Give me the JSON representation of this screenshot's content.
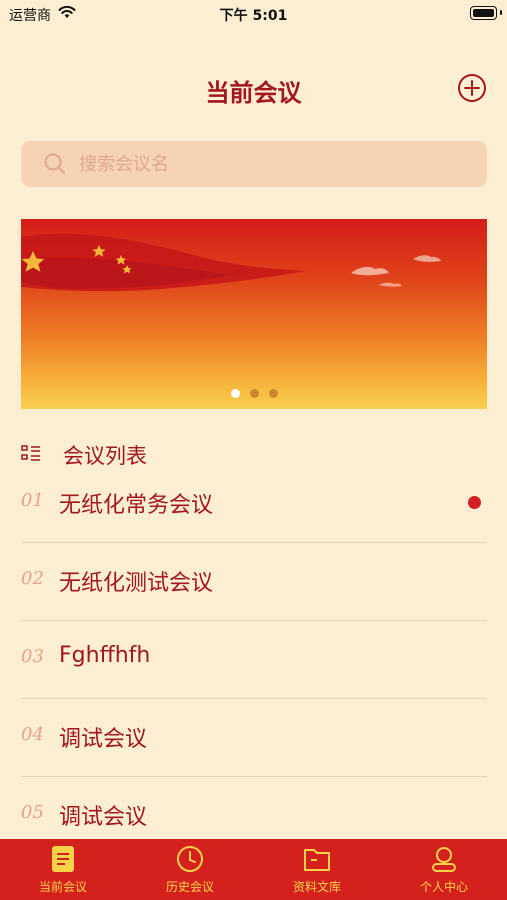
{
  "status_bar": {
    "carrier": "运营商",
    "time": "下午 5:01"
  },
  "header": {
    "title": "当前会议"
  },
  "search": {
    "placeholder": "搜索会议名",
    "value": ""
  },
  "banner": {
    "page_count": 3,
    "active_index": 0
  },
  "section": {
    "title": "会议列表"
  },
  "meetings": [
    {
      "num": "01",
      "title": "无纸化常务会议",
      "unread": true
    },
    {
      "num": "02",
      "title": "无纸化测试会议",
      "unread": false
    },
    {
      "num": "03",
      "title": "Fghffhfh",
      "unread": false
    },
    {
      "num": "04",
      "title": "调试会议",
      "unread": false
    },
    {
      "num": "05",
      "title": "调试会议",
      "unread": false
    }
  ],
  "tabs": [
    {
      "label": "当前会议",
      "icon": "document-list-icon",
      "active": true
    },
    {
      "label": "历史会议",
      "icon": "clock-icon",
      "active": false
    },
    {
      "label": "资料文库",
      "icon": "folder-icon",
      "active": false
    },
    {
      "label": "个人中心",
      "icon": "person-icon",
      "active": false
    }
  ],
  "colors": {
    "background": "#fbeed3",
    "accent": "#a3161d",
    "tabbar": "#d5211e",
    "tab_text": "#f7d349",
    "search_bg": "#f7d3b5"
  }
}
